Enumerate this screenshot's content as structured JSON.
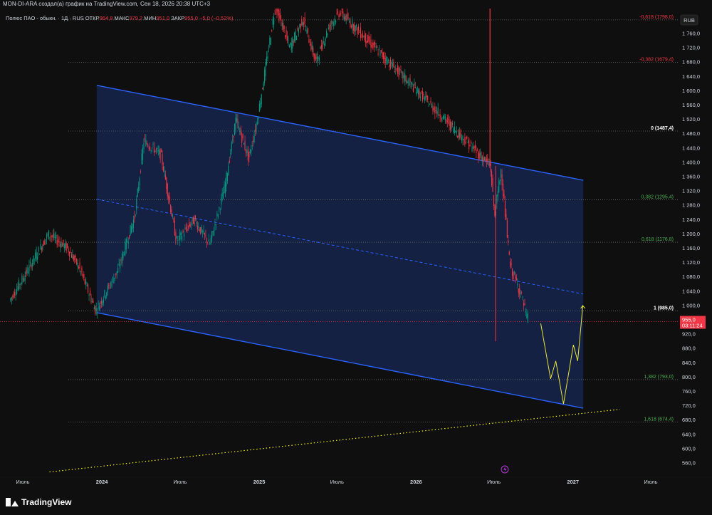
{
  "header": {
    "attribution": "MON-DI-ARA создал(а) график на TradingView.com, Сен 18, 2026 20:38 UTC+3",
    "symbol": "Полюс ПАО - обыкн.",
    "timeframe": "1Д",
    "exchange": "RUS",
    "ohlc": [
      {
        "label": "ОТКР",
        "value": "964,8"
      },
      {
        "label": "МАКС",
        "value": "979,2"
      },
      {
        "label": "МИН",
        "value": "951,0"
      },
      {
        "label": "ЗАКР",
        "value": "955,0"
      }
    ],
    "change": "−5,0 (−0,52%)"
  },
  "currency_button": "RUB",
  "price_tag": {
    "price": "955,0",
    "countdown": "03:11:24"
  },
  "footer": {
    "brand": "TradingView"
  },
  "colors": {
    "up": "#089981",
    "down": "#f23645",
    "channel": "#2962ff",
    "projection": "#e8e83a",
    "trend": "#f5f500"
  },
  "chart_data": {
    "type": "line",
    "y_axis_labels": [
      "1 760,0",
      "1 720,0",
      "1 680,0",
      "1 640,0",
      "1 600,0",
      "1 560,0",
      "1 520,0",
      "1 480,0",
      "1 440,0",
      "1 400,0",
      "1 360,0",
      "1 320,0",
      "1 280,0",
      "1 240,0",
      "1 200,0",
      "1 160,0",
      "1 120,0",
      "1 080,0",
      "1 040,0",
      "1 000,0",
      "960,0",
      "920,0",
      "880,0",
      "840,0",
      "800,0",
      "760,0",
      "720,0",
      "680,0",
      "640,0",
      "600,0",
      "560,0"
    ],
    "y_ticks": [
      1760,
      1720,
      1680,
      1640,
      1600,
      1560,
      1520,
      1480,
      1440,
      1400,
      1360,
      1320,
      1280,
      1240,
      1200,
      1160,
      1120,
      1080,
      1040,
      1000,
      960,
      920,
      880,
      840,
      800,
      760,
      720,
      680,
      640,
      600,
      560
    ],
    "ylim": [
      528,
      1840
    ],
    "x_labels": [
      "Июль",
      "2024",
      "Июль",
      "2025",
      "Июль",
      "2026",
      "Июль",
      "2027",
      "Июль"
    ],
    "x_dates": [
      "2023-07-01",
      "2024-01-01",
      "2024-07-01",
      "2025-01-01",
      "2025-07-01",
      "2026-01-01",
      "2026-07-01",
      "2027-01-01",
      "2027-07-01"
    ],
    "fib_levels": [
      {
        "ratio": "-0,618",
        "price": 1798.0,
        "label": "-0,618 (1798,0)",
        "color": "#f23645"
      },
      {
        "ratio": "-0,382",
        "price": 1679.4,
        "label": "-0,382 (1679,4)",
        "color": "#f23645"
      },
      {
        "ratio": "0",
        "price": 1487.4,
        "label": "0 (1487,4)",
        "color": "#ffffff"
      },
      {
        "ratio": "0,382",
        "price": 1295.4,
        "label": "0,382 (1295,4)",
        "color": "#4caf50"
      },
      {
        "ratio": "0,618",
        "price": 1176.8,
        "label": "0,618 (1176,8)",
        "color": "#4caf50"
      },
      {
        "ratio": "1",
        "price": 985.0,
        "label": "1 (985,0)",
        "color": "#ffffff"
      },
      {
        "ratio": "1,382",
        "price": 793.0,
        "label": "1,382 (793,0)",
        "color": "#4caf50"
      },
      {
        "ratio": "1,618",
        "price": 674.4,
        "label": "1,618 (674,4)",
        "color": "#4caf50"
      }
    ],
    "last_price": 955.0,
    "channel": {
      "upper": [
        {
          "date": "2023-12-20",
          "price": 1615
        },
        {
          "date": "2027-01-25",
          "price": 1350
        }
      ],
      "lower": [
        {
          "date": "2023-12-20",
          "price": 980
        },
        {
          "date": "2027-01-25",
          "price": 713
        }
      ],
      "mid": [
        {
          "date": "2023-12-20",
          "price": 1297
        },
        {
          "date": "2027-01-25",
          "price": 1032
        }
      ]
    },
    "trendline": [
      {
        "date": "2023-09-01",
        "price": 535
      },
      {
        "date": "2027-04-20",
        "price": 710
      }
    ],
    "projection": [
      {
        "date": "2026-10-18",
        "price": 950
      },
      {
        "date": "2026-11-10",
        "price": 795
      },
      {
        "date": "2026-11-22",
        "price": 845
      },
      {
        "date": "2026-12-10",
        "price": 725
      },
      {
        "date": "2027-01-02",
        "price": 890
      },
      {
        "date": "2027-01-12",
        "price": 845
      },
      {
        "date": "2027-01-24",
        "price": 1000
      }
    ],
    "price_path": [
      {
        "date": "2023-06-01",
        "price": 1010
      },
      {
        "date": "2023-07-15",
        "price": 1100
      },
      {
        "date": "2023-09-01",
        "price": 1200
      },
      {
        "date": "2023-10-15",
        "price": 1160
      },
      {
        "date": "2023-11-10",
        "price": 1110
      },
      {
        "date": "2023-12-20",
        "price": 985
      },
      {
        "date": "2024-02-10",
        "price": 1100
      },
      {
        "date": "2024-03-20",
        "price": 1250
      },
      {
        "date": "2024-04-10",
        "price": 1460
      },
      {
        "date": "2024-05-20",
        "price": 1420
      },
      {
        "date": "2024-06-25",
        "price": 1180
      },
      {
        "date": "2024-08-05",
        "price": 1240
      },
      {
        "date": "2024-09-10",
        "price": 1170
      },
      {
        "date": "2024-10-15",
        "price": 1330
      },
      {
        "date": "2024-11-10",
        "price": 1520
      },
      {
        "date": "2024-12-10",
        "price": 1410
      },
      {
        "date": "2024-12-30",
        "price": 1520
      },
      {
        "date": "2025-02-10",
        "price": 1840
      },
      {
        "date": "2025-03-15",
        "price": 1720
      },
      {
        "date": "2025-04-15",
        "price": 1800
      },
      {
        "date": "2025-05-15",
        "price": 1680
      },
      {
        "date": "2025-06-15",
        "price": 1780
      },
      {
        "date": "2025-07-10",
        "price": 1820
      },
      {
        "date": "2026-06-25",
        "price": 1390
      },
      {
        "date": "2026-07-05",
        "price": 1250
      },
      {
        "date": "2026-07-20",
        "price": 1380
      },
      {
        "date": "2026-08-10",
        "price": 1110
      },
      {
        "date": "2026-09-05",
        "price": 1030
      },
      {
        "date": "2026-09-20",
        "price": 955
      }
    ]
  }
}
